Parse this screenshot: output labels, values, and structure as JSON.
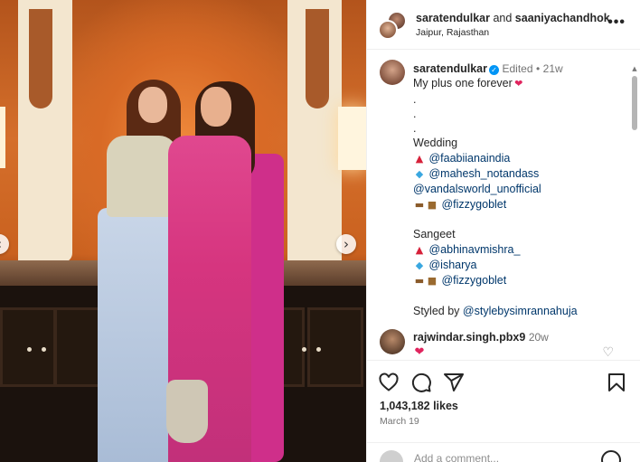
{
  "header": {
    "user1": "saratendulkar",
    "joiner": " and ",
    "user2": "saaniyachandhok",
    "location": "Jaipur, Rajasthan",
    "more_icon": "more-horizontal-icon"
  },
  "caption": {
    "username": "saratendulkar",
    "edited": "Edited",
    "bullet": "•",
    "age": "21w",
    "title": "My plus one forever",
    "dots": [
      ".",
      ".",
      "."
    ],
    "wedding_heading": "Wedding",
    "wedding_tags": [
      {
        "icons": "👗",
        "tag": "@faabiianaindia"
      },
      {
        "icons": "💎",
        "tag": "@mahesh_notandass"
      },
      {
        "icons": "",
        "tag": "@vandalsworld_unofficial"
      },
      {
        "icons": "👡👜",
        "tag": "@fizzygoblet"
      }
    ],
    "sangeet_heading": "Sangeet",
    "sangeet_tags": [
      {
        "icons": "👗",
        "tag": "@abhinavmishra_"
      },
      {
        "icons": "💎",
        "tag": "@isharya"
      },
      {
        "icons": "👡👜",
        "tag": "@fizzygoblet"
      }
    ],
    "styled_by_label": "Styled by",
    "styled_by_tag": "@stylebysimrannahuja"
  },
  "comment": {
    "username": "rajwindar.singh.pbx9",
    "age": "20w",
    "text": "❤"
  },
  "actions": {
    "likes": "1,043,182 likes",
    "date": "March 19",
    "add_comment_placeholder": "Add a comment..."
  },
  "colors": {
    "accent": "#0095f6",
    "link": "#00376b",
    "heart": "#e0245e"
  }
}
